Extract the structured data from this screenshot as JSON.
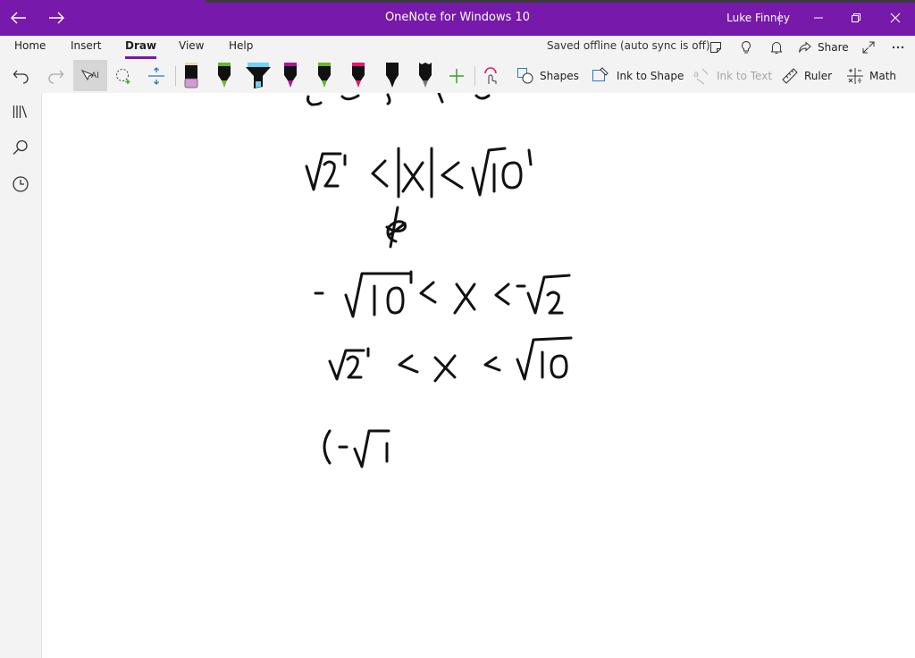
{
  "window": {
    "title": "OneNote for Windows 10",
    "user": "Luke Finney"
  },
  "ribbon": {
    "tabs": [
      {
        "label": "Home"
      },
      {
        "label": "Insert"
      },
      {
        "label": "Draw",
        "active": true
      },
      {
        "label": "View"
      },
      {
        "label": "Help"
      }
    ],
    "status": "Saved offline (auto sync is off)",
    "share_label": "Share"
  },
  "toolbar": {
    "pens": [
      {
        "kind": "eraser",
        "color": "#111111",
        "accent": "#d39bd6"
      },
      {
        "kind": "pen",
        "color": "#111111",
        "accent": "#6ab52e"
      },
      {
        "kind": "highlighter",
        "color": "#111111",
        "accent": "#6fd1f5"
      },
      {
        "kind": "pen",
        "color": "#111111",
        "accent": "#a8199a"
      },
      {
        "kind": "pen",
        "color": "#111111",
        "accent": "#6ab52e"
      },
      {
        "kind": "pen",
        "color": "#111111",
        "accent": "#e6186f"
      },
      {
        "kind": "pen",
        "color": "#111111",
        "accent": "#111111"
      },
      {
        "kind": "pen",
        "color": "#111111",
        "accent": "#111111"
      }
    ],
    "shapes_label": "Shapes",
    "ink_to_shape_label": "Ink to Shape",
    "ink_to_text_label": "Ink to Text",
    "ruler_label": "Ruler",
    "math_label": "Math"
  },
  "colors": {
    "accent": "#7719aa",
    "ribbon_bg": "#f3f3f3"
  }
}
